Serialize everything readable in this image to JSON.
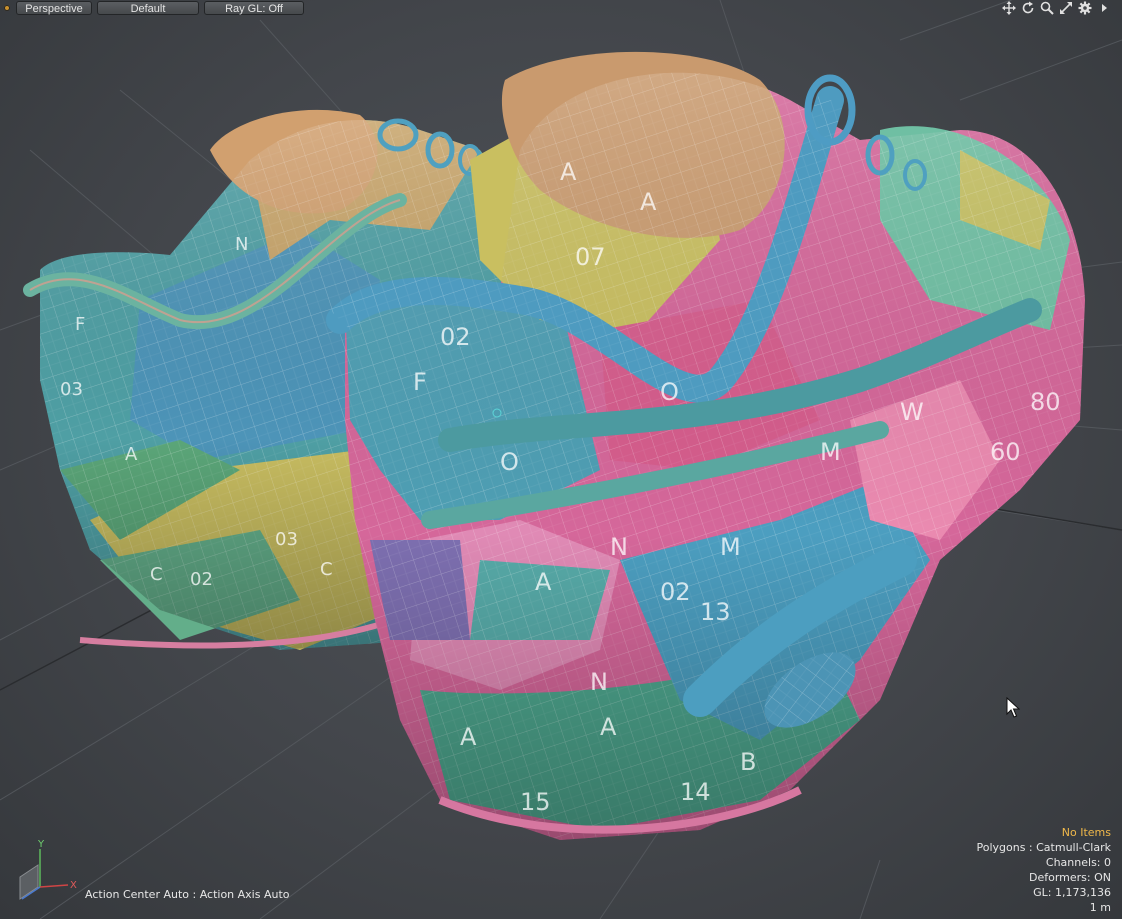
{
  "header": {
    "view_label": "Perspective",
    "style_label": "Default",
    "raygl_label": "Ray GL: Off",
    "tools": [
      "move-view-icon",
      "rotate-view-icon",
      "zoom-view-icon",
      "maximize-view-icon",
      "settings-icon",
      "expand-arrow-icon"
    ]
  },
  "status": {
    "action_center": "Action Center Auto : Action Axis Auto"
  },
  "info": {
    "selection": "No Items",
    "polygons": "Polygons : Catmull-Clark",
    "channels": "Channels: 0",
    "deformers": "Deformers: ON",
    "gl": "GL: 1,173,136",
    "scale": "1 m"
  },
  "gizmo": {
    "y": "Y",
    "x": "X"
  },
  "colors": {
    "accent": "#f0b84a",
    "teal": "#4fa99d",
    "blue": "#4c8fb5",
    "pink": "#d65d8d",
    "yellow": "#c9bd5e",
    "green": "#5aa67a",
    "purple": "#7d6fb0"
  }
}
